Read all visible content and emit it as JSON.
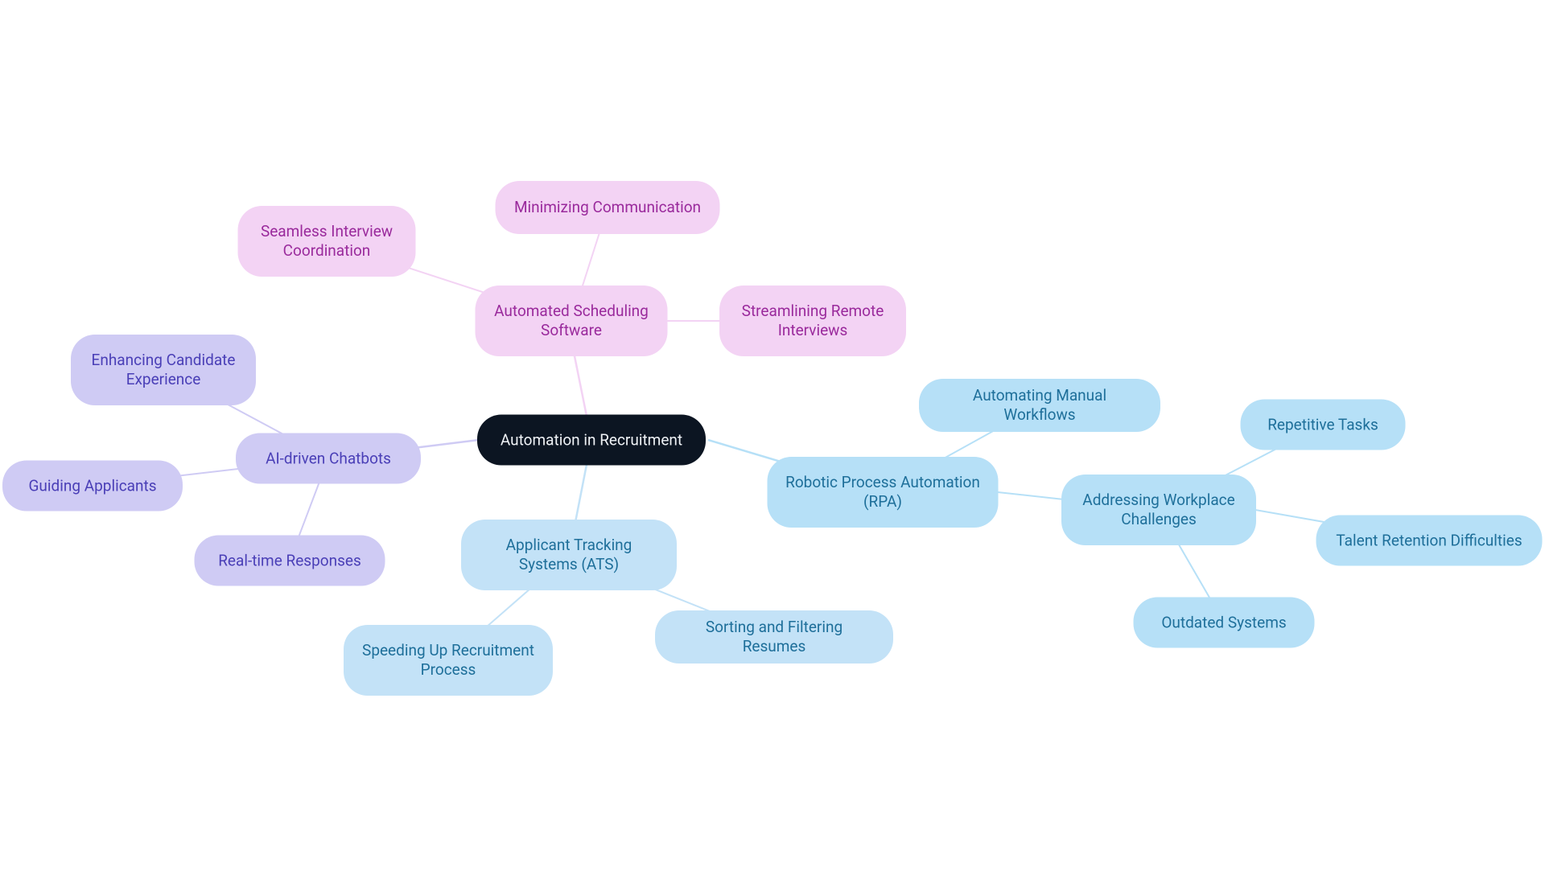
{
  "root": {
    "label": "Automation in Recruitment"
  },
  "pink": {
    "hub": "Automated Scheduling Software",
    "a": "Seamless Interview Coordination",
    "b": "Minimizing Communication",
    "c": "Streamlining Remote Interviews"
  },
  "lav": {
    "hub": "AI-driven Chatbots",
    "a": "Enhancing Candidate Experience",
    "b": "Guiding Applicants",
    "c": "Real-time Responses"
  },
  "blue_ats": {
    "hub": "Applicant Tracking Systems (ATS)",
    "a": "Speeding Up Recruitment Process",
    "b": "Sorting and Filtering Resumes"
  },
  "blue_rpa": {
    "hub": "Robotic Process Automation (RPA)",
    "sub_hub": "Addressing Workplace Challenges",
    "a": "Automating Manual Workflows",
    "c1": "Repetitive Tasks",
    "c2": "Talent Retention Difficulties",
    "c3": "Outdated Systems"
  },
  "colors": {
    "edge_pink": "#f3d3f4",
    "edge_lav": "#cfcbf4",
    "edge_blue1": "#c3e2f7",
    "edge_blue2": "#b6e0f7"
  }
}
